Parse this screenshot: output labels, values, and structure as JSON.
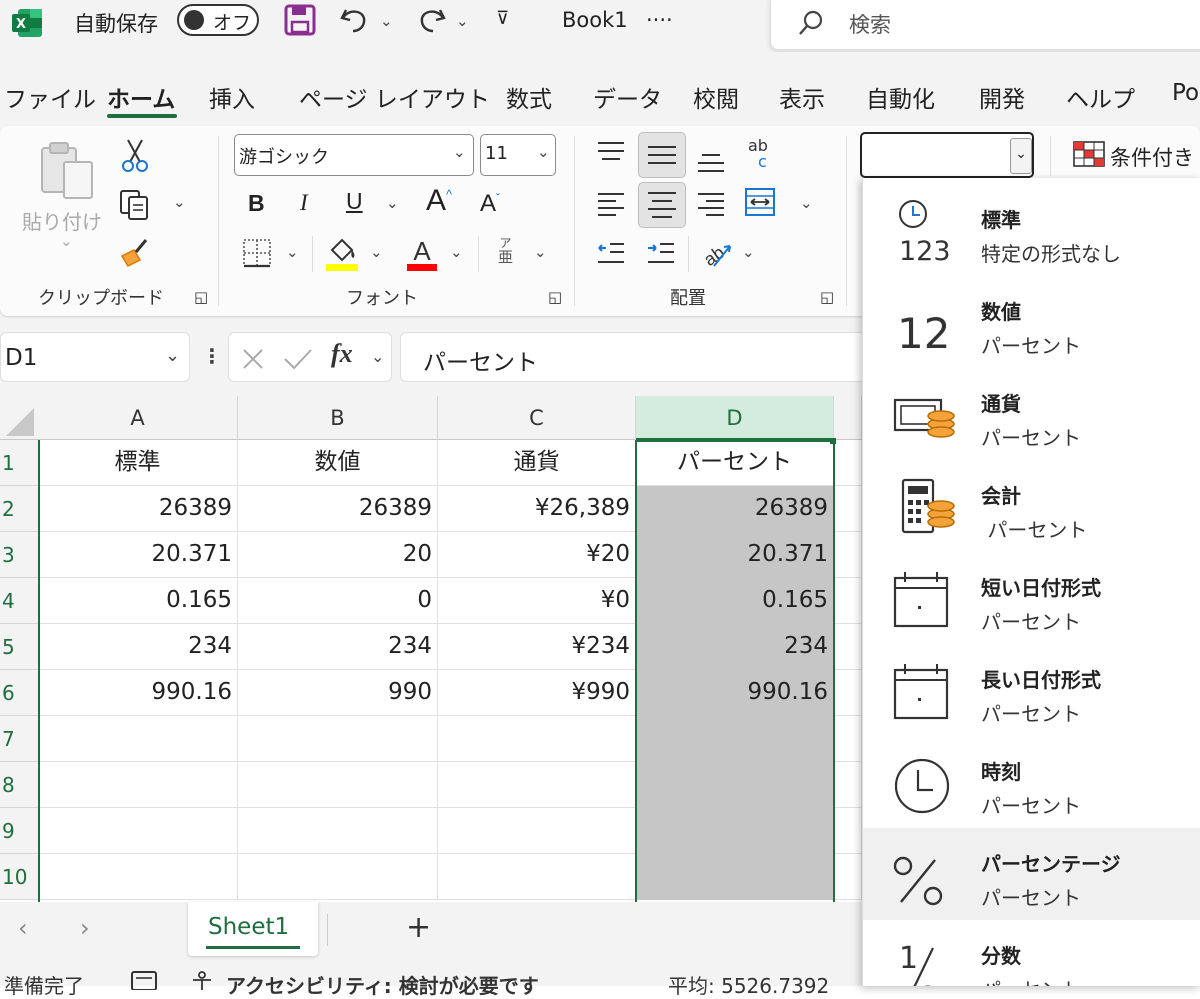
{
  "titlebar": {
    "app_icon": "excel-logo",
    "autosave_label": "自動保存",
    "autosave_toggle": "オフ",
    "book_title": "Book1",
    "book_more": "····",
    "search_placeholder": "検索"
  },
  "tabs": [
    {
      "label": "ファイル"
    },
    {
      "label": "ホーム",
      "active": true
    },
    {
      "label": "挿入"
    },
    {
      "label": "ページ レイアウト"
    },
    {
      "label": "数式"
    },
    {
      "label": "データ"
    },
    {
      "label": "校閲"
    },
    {
      "label": "表示"
    },
    {
      "label": "自動化"
    },
    {
      "label": "開発"
    },
    {
      "label": "ヘルプ"
    },
    {
      "label": "Po"
    }
  ],
  "ribbon": {
    "clipboard": {
      "paste_label": "貼り付け",
      "group_label": "クリップボード"
    },
    "font": {
      "font_name": "游ゴシック",
      "font_size": "11",
      "bold": "B",
      "italic": "I",
      "underline": "U",
      "grow": "A",
      "shrink": "A",
      "font_color": "A",
      "phonetic_top": "ア",
      "phonetic_bottom": "亜",
      "group_label": "フォント",
      "fill_color": "#ffff00",
      "text_color": "#ff0000"
    },
    "alignment": {
      "group_label": "配置",
      "wrap_top": "ab",
      "wrap_bottom": "c"
    },
    "number": {
      "format_value": "",
      "conditional_label": "条件付き"
    }
  },
  "formula_bar": {
    "name_box": "D1",
    "fx_label": "fx",
    "value": "パーセント"
  },
  "grid": {
    "columns": [
      "A",
      "B",
      "C",
      "D"
    ],
    "row_numbers": [
      "1",
      "2",
      "3",
      "4",
      "5",
      "6",
      "7",
      "8",
      "9",
      "10"
    ],
    "rows": [
      [
        "標準",
        "数値",
        "通貨",
        "パーセント"
      ],
      [
        "26389",
        "26389",
        "¥26,389",
        "26389"
      ],
      [
        "20.371",
        "20",
        "¥20",
        "20.371"
      ],
      [
        "0.165",
        "0",
        "¥0",
        "0.165"
      ],
      [
        "234",
        "234",
        "¥234",
        "234"
      ],
      [
        "990.16",
        "990",
        "¥990",
        "990.16"
      ],
      [
        "",
        "",
        "",
        ""
      ],
      [
        "",
        "",
        "",
        ""
      ],
      [
        "",
        "",
        "",
        ""
      ],
      [
        "",
        "",
        "",
        ""
      ]
    ],
    "selected_column": "D"
  },
  "sheet_tabs": {
    "sheets": [
      "Sheet1"
    ],
    "add": "+"
  },
  "status": {
    "ready": "準備完了",
    "accessibility": "アクセシビリティ: 検討が必要です",
    "average": "平均: 5526.7392"
  },
  "number_format_menu": [
    {
      "title": "標準",
      "subtitle": "特定の形式なし",
      "icon": "clock-123-icon"
    },
    {
      "title": "数値",
      "subtitle": "パーセント",
      "icon": "number-12-icon"
    },
    {
      "title": "通貨",
      "subtitle": "パーセント",
      "icon": "currency-icon"
    },
    {
      "title": "会計",
      "subtitle": " パーセント",
      "icon": "accounting-icon"
    },
    {
      "title": "短い日付形式",
      "subtitle": "パーセント",
      "icon": "calendar-short-icon"
    },
    {
      "title": "長い日付形式",
      "subtitle": "パーセント",
      "icon": "calendar-long-icon"
    },
    {
      "title": "時刻",
      "subtitle": "パーセント",
      "icon": "clock-icon"
    },
    {
      "title": "パーセンテージ",
      "subtitle": "パーセント",
      "icon": "percent-icon",
      "highlighted": true
    },
    {
      "title": "分数",
      "subtitle": "パーセント",
      "icon": "fraction-icon"
    }
  ],
  "colors": {
    "excel_green": "#1e6e3f",
    "selection_fill": "#c6c6c6",
    "purple_save": "#8a2f8f"
  }
}
